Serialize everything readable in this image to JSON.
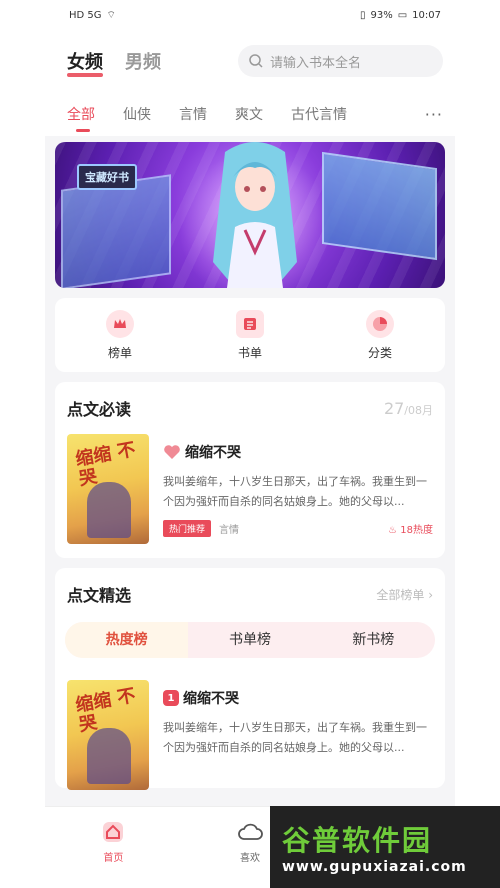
{
  "status_bar": {
    "left": "HD 5G",
    "battery": "93%",
    "time": "10:07"
  },
  "gender_tabs": [
    {
      "label": "女频",
      "active": true
    },
    {
      "label": "男频",
      "active": false
    }
  ],
  "search": {
    "placeholder": "请输入书本全名"
  },
  "categories": [
    {
      "label": "全部",
      "active": true
    },
    {
      "label": "仙侠"
    },
    {
      "label": "言情"
    },
    {
      "label": "爽文"
    },
    {
      "label": "古代言情"
    }
  ],
  "more_label": "···",
  "banner": {
    "tag": "宝藏好书"
  },
  "quick_entries": [
    {
      "label": "榜单",
      "icon": "crown-icon"
    },
    {
      "label": "书单",
      "icon": "list-icon"
    },
    {
      "label": "分类",
      "icon": "pie-icon"
    }
  ],
  "daily": {
    "title": "点文必读",
    "date_day": "27",
    "date_month": "/08月",
    "book": {
      "title": "缩缩不哭",
      "cover_text": "缩缩 不哭",
      "desc": "我叫姜缩年，十八岁生日那天，出了车祸。我重生到一个因为强奸而自杀的同名姑娘身上。她的父母以...",
      "tag": "热门推荐",
      "genre": "言情",
      "heat": "18热度"
    }
  },
  "picks": {
    "title": "点文精选",
    "more": "全部榜单 ›",
    "tabs": [
      {
        "label": "热度榜",
        "active": true
      },
      {
        "label": "书单榜"
      },
      {
        "label": "新书榜"
      }
    ],
    "book": {
      "rank": "1",
      "title": "缩缩不哭",
      "cover_text": "缩缩 不哭",
      "desc": "我叫姜缩年，十八岁生日那天，出了车祸。我重生到一个因为强奸而自杀的同名姑娘身上。她的父母以..."
    }
  },
  "tabbar": [
    {
      "label": "首页",
      "active": true,
      "icon": "home-icon"
    },
    {
      "label": "喜欢",
      "icon": "cloud-icon"
    }
  ],
  "watermark": {
    "big": "谷普软件园",
    "small": "www.gupuxiazai.com"
  },
  "colors": {
    "accent": "#e94b5a",
    "background": "#f5f5f7"
  }
}
